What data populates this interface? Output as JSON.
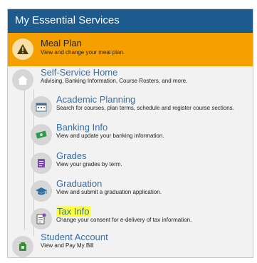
{
  "header": {
    "title": "My Essential Services"
  },
  "meal_plan": {
    "title": "Meal Plan",
    "desc": "View and change your meal plan."
  },
  "self_service": {
    "title": "Self-Service Home",
    "desc": "Advising, Banking Information, Course Rosters, and more.",
    "children": [
      {
        "title": "Academic Planning",
        "desc": "Search for courses, plan terms, schedule and register course sections."
      },
      {
        "title": "Banking Info",
        "desc": "View and update your banking information."
      },
      {
        "title": "Grades",
        "desc": "View your grades by term."
      },
      {
        "title": "Graduation",
        "desc": "View and submit a graduation application."
      },
      {
        "title": "Tax Info",
        "desc": "Change your consent for e-delivery of tax information."
      }
    ]
  },
  "student_account": {
    "title": "Student Account",
    "desc": "View and Pay My Bill"
  },
  "colors": {
    "header_bg": "#1d5a8e",
    "alert": "#f5a000",
    "link_blue": "#3a6fa4",
    "grades_purple": "#7c4bb0",
    "banking_green": "#2e9a4a",
    "account_green": "#3c8a3c"
  },
  "icons": [
    "warning-icon",
    "home-icon",
    "calendar-icon",
    "money-icon",
    "grades-icon",
    "graduation-cap-icon",
    "tax-document-icon",
    "wallet-icon"
  ]
}
